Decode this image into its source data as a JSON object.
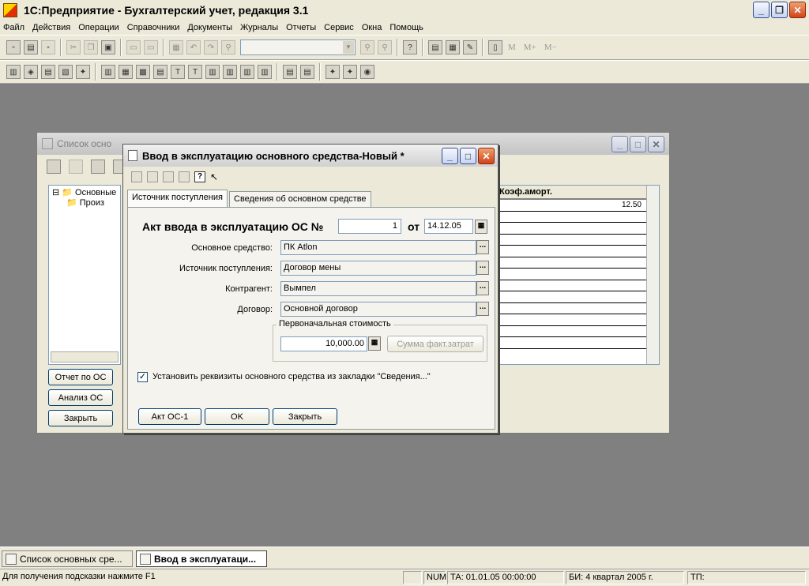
{
  "app": {
    "title": "1С:Предприятие - Бухгалтерский учет, редакция 3.1"
  },
  "menu": [
    "Файл",
    "Действия",
    "Операции",
    "Справочники",
    "Документы",
    "Журналы",
    "Отчеты",
    "Сервис",
    "Окна",
    "Помощь"
  ],
  "toolbar": {
    "memory_buttons": [
      "M",
      "M+",
      "M−"
    ]
  },
  "list_window": {
    "title": "Список осно",
    "tree_items": [
      "Основные",
      "Произ"
    ],
    "grid_header": "Коэф.аморт.",
    "grid_value": "12.50",
    "buttons": [
      "Отчет по ОС",
      "Анализ ОС",
      "Закрыть"
    ]
  },
  "dialog": {
    "title": "Ввод в эксплуатацию основного средства-Новый *",
    "tabs": [
      "Источник поступления",
      "Сведения об основном средстве"
    ],
    "act_label": "Акт ввода в эксплуатацию ОС №",
    "act_number": "1",
    "from_label": "от",
    "date": "14.12.05",
    "fields": [
      {
        "label": "Основное средство:",
        "value": "ПК Atlon"
      },
      {
        "label": "Источник поступления:",
        "value": "Договор мены"
      },
      {
        "label": "Контрагент:",
        "value": "Вымпел"
      },
      {
        "label": "Договор:",
        "value": "Основной договор"
      }
    ],
    "group_title": "Первоначальная стоимость",
    "cost_value": "10,000.00",
    "sum_button": "Сумма факт.затрат",
    "checkbox_label": "Установить реквизиты основного средства из закладки \"Сведения...\"",
    "checkbox_checked": true,
    "buttons": [
      "Акт ОС-1",
      "OK",
      "Закрыть"
    ]
  },
  "taskbar": {
    "items": [
      "Список основных сре...",
      "Ввод в эксплуатаци..."
    ]
  },
  "status": {
    "hint": "Для получения подсказки нажмите F1",
    "num": "NUM",
    "ta": "ТА: 01.01.05  00:00:00",
    "bi": "БИ: 4 квартал 2005 г.",
    "tp": "ТП:"
  }
}
